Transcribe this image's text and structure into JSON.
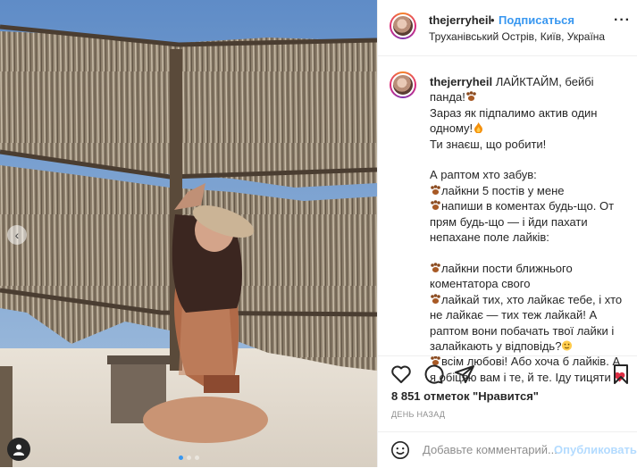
{
  "post": {
    "username": "thejerryheil",
    "follow_label": "Подписаться",
    "separator": "•",
    "location": "Труханівський Острів, Київ, Україна",
    "more_label": "···"
  },
  "caption": {
    "username": "thejerryheil",
    "lines": [
      "ЛАЙКТАЙМ, бейбі панда!",
      "Зараз як підпалимо актив один одному!",
      "Ти знаєш, що робити!",
      "",
      "А раптом хто забув:",
      "лайкни 5 постів у мене",
      "напиши в коментах будь-що. От прям будь-що — і йди пахати непахане поле лайків:",
      "",
      "лайкни пости ближнього коментатора свого",
      "лайкай тих, хто лайкає тебе, і хто не лайкає — тих теж лайкай! А раптом вони побачать твої лайки і залайкають у відповідь?",
      "всім любові! Або хоча б лайків. А я обіцяю вам і те, й те. Іду тицяти"
    ]
  },
  "likes_text": "8 851 отметок \"Нравится\"",
  "time_text": "ДЕНЬ НАЗАД",
  "comment": {
    "placeholder": "Добавьте комментарий...",
    "post_label": "Опубликовать"
  },
  "carousel": {
    "count": 3,
    "active": 1
  },
  "colors": {
    "link": "#3897f0",
    "post_disabled": "#b3dbff",
    "heart": "#ed4956",
    "text": "#262626",
    "muted": "#8e8e8e"
  },
  "icons": [
    "chevron-left-icon",
    "user-tag-icon",
    "heart-icon",
    "comment-icon",
    "share-icon",
    "bookmark-icon",
    "emoji-icon",
    "paw-emoji-icon",
    "fire-emoji-icon",
    "sly-emoji-icon",
    "red-heart-emoji-icon"
  ]
}
